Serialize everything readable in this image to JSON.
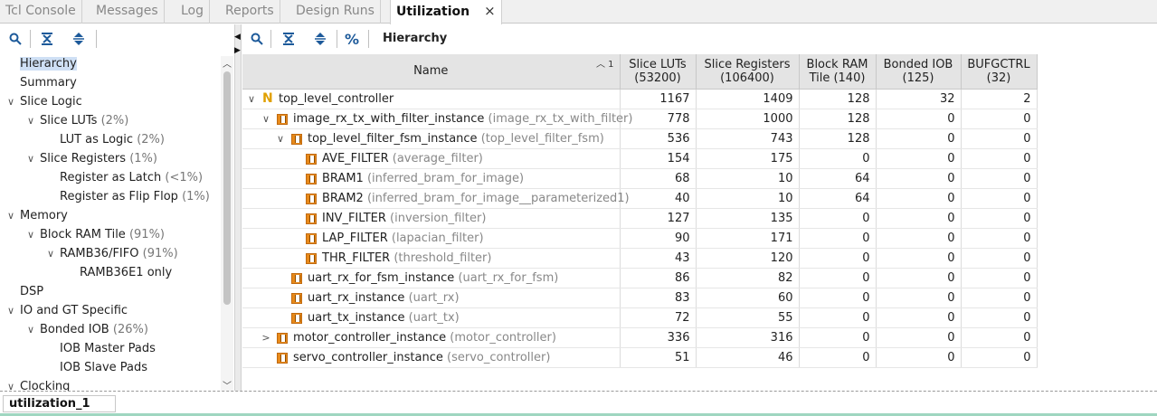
{
  "tabs": [
    {
      "label": "Tcl Console"
    },
    {
      "label": "Messages"
    },
    {
      "label": "Log"
    },
    {
      "label": "Reports"
    },
    {
      "label": "Design Runs"
    },
    {
      "label": "Utilization",
      "active": true,
      "close": "×"
    }
  ],
  "toolbar_right": {
    "percent": "%",
    "title": "Hierarchy"
  },
  "sidebar": [
    {
      "label": "Hierarchy",
      "pct": "",
      "chevron": ""
    },
    {
      "label": "Summary",
      "pct": "",
      "chevron": ""
    },
    {
      "label": "Slice Logic",
      "pct": "",
      "chevron": "∨"
    },
    {
      "label": "Slice LUTs",
      "pct": "(2%)",
      "chevron": "∨"
    },
    {
      "label": "LUT as Logic",
      "pct": "(2%)",
      "chevron": ""
    },
    {
      "label": "Slice Registers",
      "pct": "(1%)",
      "chevron": "∨"
    },
    {
      "label": "Register as Latch",
      "pct": "(<1%)",
      "chevron": ""
    },
    {
      "label": "Register as Flip Flop",
      "pct": "(1%)",
      "chevron": ""
    },
    {
      "label": "Memory",
      "pct": "",
      "chevron": "∨"
    },
    {
      "label": "Block RAM Tile",
      "pct": "(91%)",
      "chevron": "∨"
    },
    {
      "label": "RAMB36/FIFO",
      "pct": "(91%)",
      "chevron": "∨"
    },
    {
      "label": "RAMB36E1 only",
      "pct": "",
      "chevron": ""
    },
    {
      "label": "DSP",
      "pct": "",
      "chevron": ""
    },
    {
      "label": "IO and GT Specific",
      "pct": "",
      "chevron": "∨"
    },
    {
      "label": "Bonded IOB",
      "pct": "(26%)",
      "chevron": "∨"
    },
    {
      "label": "IOB Master Pads",
      "pct": "",
      "chevron": ""
    },
    {
      "label": "IOB Slave Pads",
      "pct": "",
      "chevron": ""
    },
    {
      "label": "Clocking",
      "pct": "",
      "chevron": "∨"
    }
  ],
  "table": {
    "headers": [
      {
        "l1": "Name",
        "l2": ""
      },
      {
        "l1": "Slice LUTs",
        "l2": "(53200)"
      },
      {
        "l1": "Slice Registers",
        "l2": "(106400)"
      },
      {
        "l1": "Block RAM",
        "l2": "Tile (140)"
      },
      {
        "l1": "Bonded IOB",
        "l2": "(125)"
      },
      {
        "l1": "BUFGCTRL",
        "l2": "(32)"
      }
    ],
    "sort_indicator": "1",
    "rows": [
      {
        "inst": "top_level_controller",
        "mod": "",
        "chev": "∨",
        "icon": "N",
        "vals": [
          "1167",
          "1409",
          "128",
          "32",
          "2"
        ]
      },
      {
        "inst": "image_rx_tx_with_filter_instance",
        "mod": "(image_rx_tx_with_filter)",
        "chev": "∨",
        "icon": "I",
        "vals": [
          "778",
          "1000",
          "128",
          "0",
          "0"
        ]
      },
      {
        "inst": "top_level_filter_fsm_instance",
        "mod": "(top_level_filter_fsm)",
        "chev": "∨",
        "icon": "I",
        "vals": [
          "536",
          "743",
          "128",
          "0",
          "0"
        ]
      },
      {
        "inst": "AVE_FILTER",
        "mod": "(average_filter)",
        "chev": "",
        "icon": "I",
        "vals": [
          "154",
          "175",
          "0",
          "0",
          "0"
        ]
      },
      {
        "inst": "BRAM1",
        "mod": "(inferred_bram_for_image)",
        "chev": "",
        "icon": "I",
        "vals": [
          "68",
          "10",
          "64",
          "0",
          "0"
        ]
      },
      {
        "inst": "BRAM2",
        "mod": "(inferred_bram_for_image__parameterized1)",
        "chev": "",
        "icon": "I",
        "vals": [
          "40",
          "10",
          "64",
          "0",
          "0"
        ]
      },
      {
        "inst": "INV_FILTER",
        "mod": "(inversion_filter)",
        "chev": "",
        "icon": "I",
        "vals": [
          "127",
          "135",
          "0",
          "0",
          "0"
        ]
      },
      {
        "inst": "LAP_FILTER",
        "mod": "(lapacian_filter)",
        "chev": "",
        "icon": "I",
        "vals": [
          "90",
          "171",
          "0",
          "0",
          "0"
        ]
      },
      {
        "inst": "THR_FILTER",
        "mod": "(threshold_filter)",
        "chev": "",
        "icon": "I",
        "vals": [
          "43",
          "120",
          "0",
          "0",
          "0"
        ]
      },
      {
        "inst": "uart_rx_for_fsm_instance",
        "mod": "(uart_rx_for_fsm)",
        "chev": "",
        "icon": "I",
        "vals": [
          "86",
          "82",
          "0",
          "0",
          "0"
        ]
      },
      {
        "inst": "uart_rx_instance",
        "mod": "(uart_rx)",
        "chev": "",
        "icon": "I",
        "vals": [
          "83",
          "60",
          "0",
          "0",
          "0"
        ]
      },
      {
        "inst": "uart_tx_instance",
        "mod": "(uart_tx)",
        "chev": "",
        "icon": "I",
        "vals": [
          "72",
          "55",
          "0",
          "0",
          "0"
        ]
      },
      {
        "inst": "motor_controller_instance",
        "mod": "(motor_controller)",
        "chev": ">",
        "icon": "I",
        "vals": [
          "336",
          "316",
          "0",
          "0",
          "0"
        ]
      },
      {
        "inst": "servo_controller_instance",
        "mod": "(servo_controller)",
        "chev": "",
        "icon": "I",
        "vals": [
          "51",
          "46",
          "0",
          "0",
          "0"
        ]
      }
    ]
  },
  "status": {
    "label": "utilization_1"
  }
}
